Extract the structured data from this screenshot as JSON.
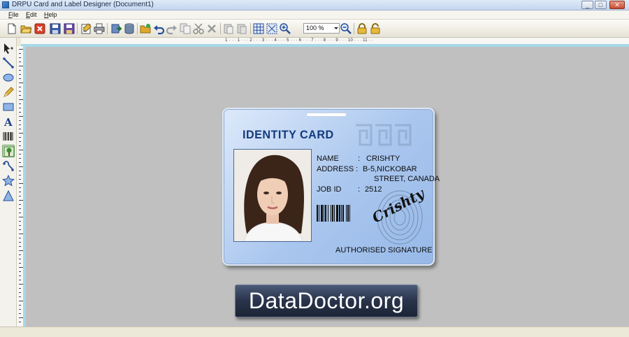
{
  "window": {
    "title": "DRPU Card and Label Designer  (Document1)",
    "minimize": "_",
    "maximize": "□",
    "close": "✕"
  },
  "menu": {
    "items": [
      {
        "label": "File",
        "mnemonic": "F"
      },
      {
        "label": "Edit",
        "mnemonic": "E"
      },
      {
        "label": "Help",
        "mnemonic": "H"
      }
    ]
  },
  "toolbar": {
    "zoom_value": "100 %",
    "icons": [
      "new-icon",
      "open-icon",
      "close-doc-icon",
      "save-icon",
      "save-as-icon",
      "properties-icon",
      "print-icon",
      "export-icon",
      "database-icon",
      "open-folder-icon",
      "undo-icon",
      "redo-icon",
      "copy-icon",
      "cut-icon",
      "delete-icon",
      "paste-icon",
      "paste-special-icon",
      "grid-icon",
      "snap-grid-icon",
      "zoom-in-icon",
      "zoom-out-icon",
      "lock-icon",
      "unlock-icon"
    ]
  },
  "ruler": {
    "top_ticks": "1 · · · 1 · · · 2 · · · 3 · · · 4 · · · 5 · · · 6 · · · 7 · · · 8 · · · 9 · · · 10 · · · 11 · ·"
  },
  "tools": [
    "select-arrow-icon",
    "line-tool-icon",
    "ellipse-tool-icon",
    "pencil-tool-icon",
    "rectangle-tool-icon",
    "text-tool-icon",
    "barcode-tool-icon",
    "image-tool-icon",
    "curve-tool-icon",
    "star-tool-icon",
    "triangle-tool-icon"
  ],
  "card": {
    "title": "IDENTITY CARD",
    "name_label": "NAME",
    "name_sep": ":",
    "name_value": "CRISHTY",
    "address_label": "ADDRESS",
    "address_sep": ":",
    "address_line1": "B-5,NICKOBAR",
    "address_line2": "STREET, CANADA",
    "jobid_label": "JOB ID",
    "jobid_sep": ":",
    "jobid_value": "2512",
    "signature": "Crishty",
    "authorised": "AUTHORISED SIGNATURE"
  },
  "banner": {
    "text": "DataDoctor.org"
  },
  "colors": {
    "canvas": "#c0c0c0",
    "card_title": "#123a7c",
    "banner_bg": "#28334a"
  }
}
